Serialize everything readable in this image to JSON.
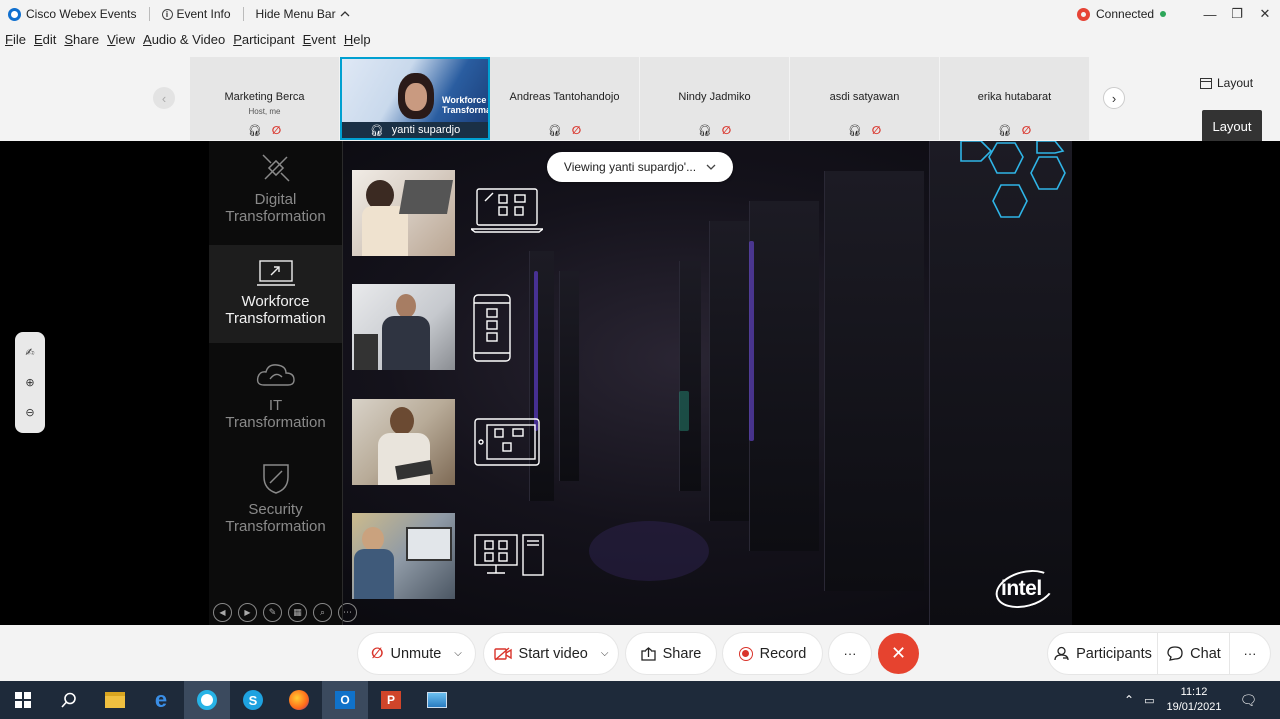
{
  "window": {
    "app_title": "Cisco Webex Events",
    "event_info": "Event Info",
    "hide_menu": "Hide Menu Bar",
    "status": "Connected"
  },
  "menu": [
    "File",
    "Edit",
    "Share",
    "View",
    "Audio & Video",
    "Participant",
    "Event",
    "Help"
  ],
  "participants": [
    {
      "name": "Marketing Berca",
      "role": "Host, me"
    },
    {
      "name": "yanti supardjo",
      "role": ""
    },
    {
      "name": "Andreas Tantohandojo",
      "role": ""
    },
    {
      "name": "Nindy Jadmiko",
      "role": ""
    },
    {
      "name": "asdi satyawan",
      "role": ""
    },
    {
      "name": "erika hutabarat",
      "role": ""
    }
  ],
  "active_tile_caption": "Workforce Transformation",
  "layout": {
    "label": "Layout",
    "tooltip": "Layout"
  },
  "viewing": "Viewing yanti supardjo'...",
  "slide": {
    "left_items": [
      {
        "l1": "Digital",
        "l2": "Transformation"
      },
      {
        "l1": "Workforce",
        "l2": "Transformation"
      },
      {
        "l1": "IT",
        "l2": "Transformation"
      },
      {
        "l1": "Security",
        "l2": "Transformation"
      }
    ],
    "brand": "intel"
  },
  "controls": {
    "unmute": "Unmute",
    "start_video": "Start video",
    "share": "Share",
    "record": "Record",
    "more": "···",
    "participants": "Participants",
    "chat": "Chat"
  },
  "taskbar": {
    "time": "11:12",
    "date": "19/01/2021"
  }
}
